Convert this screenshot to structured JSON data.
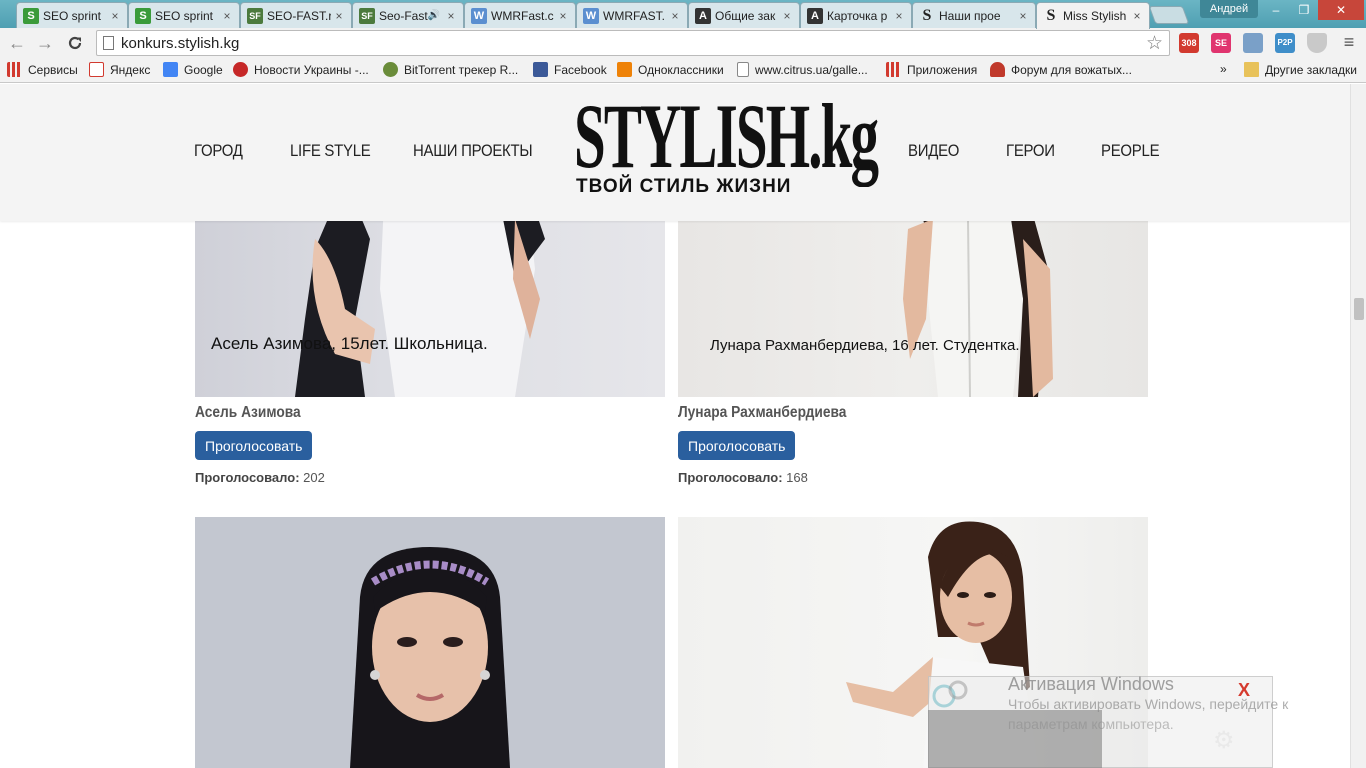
{
  "browser": {
    "tabs": [
      {
        "title": "SEO sprint",
        "icon": "seo-sprint-favicon",
        "color": "#3a9b3a"
      },
      {
        "title": "SEO sprint",
        "icon": "seo-sprint-favicon",
        "color": "#3a9b3a"
      },
      {
        "title": "SEO-FAST.ru",
        "icon": "seo-fast-favicon",
        "color": "#4c7a3d"
      },
      {
        "title": "Seo-Fast",
        "icon": "seo-fast-favicon",
        "color": "#4c7a3d",
        "audio": "🔊"
      },
      {
        "title": "WMRFast.c",
        "icon": "wmrfast-favicon",
        "color": "#5b8fd0"
      },
      {
        "title": "WMRFAST.",
        "icon": "wmrfast-favicon",
        "color": "#5b8fd0"
      },
      {
        "title": "Общие зак",
        "icon": "a-favicon",
        "color": "#333"
      },
      {
        "title": "Карточка р",
        "icon": "a-favicon",
        "color": "#333"
      },
      {
        "title": "Наши прое",
        "icon": "s-favicon",
        "color": "#fff"
      },
      {
        "title": "Miss Stylish",
        "icon": "s-favicon",
        "color": "#fff",
        "active": true
      }
    ],
    "close_glyph": "×",
    "user_name": "Андрей",
    "window_buttons": {
      "minimize": "–",
      "restore": "❐",
      "close": "✕"
    },
    "nav": {
      "back": "←",
      "forward": "→",
      "reload": "C"
    },
    "url": "konkurs.stylish.kg",
    "star_glyph": "☆",
    "extensions": [
      {
        "name": "mail-extension-icon",
        "label": "308",
        "color": "#d23a2f"
      },
      {
        "name": "se-extension-icon",
        "label": "SE",
        "color": "#e0356f"
      },
      {
        "name": "rds-extension-icon",
        "label": "",
        "color": "#7aa0c8"
      },
      {
        "name": "p2p-extension-icon",
        "label": "P2P",
        "color": "#3f8ec9"
      },
      {
        "name": "shield-extension-icon",
        "label": "",
        "color": "#bbb"
      },
      {
        "name": "menu-icon",
        "label": "≡",
        "color": "#f2f2f2"
      }
    ],
    "bookmarks": [
      {
        "label": "Сервисы",
        "icon": "apps-grid-icon",
        "color": "#d23a2f"
      },
      {
        "label": "Яндекс",
        "icon": "yandex-icon",
        "color": "#d23a2f"
      },
      {
        "label": "Google",
        "icon": "google-icon",
        "color": "#4285f4"
      },
      {
        "label": "Новости Украины -...",
        "icon": "news-ua-icon",
        "color": "#c62828"
      },
      {
        "label": "BitTorrent трекер R...",
        "icon": "torrent-icon",
        "color": "#6a8c3a"
      },
      {
        "label": "Facebook",
        "icon": "facebook-icon",
        "color": "#3b5998"
      },
      {
        "label": "Одноклассники",
        "icon": "ok-icon",
        "color": "#ee8208"
      },
      {
        "label": "www.citrus.ua/galle...",
        "icon": "page-icon",
        "color": "#fff"
      },
      {
        "label": "Приложения",
        "icon": "apps-grid-icon",
        "color": "#d23a2f"
      },
      {
        "label": "Форум для вожатых...",
        "icon": "forum-icon",
        "color": "#c0392b"
      }
    ],
    "bookmarks_overflow": "»",
    "other_bookmarks": "Другие закладки"
  },
  "site": {
    "nav_left": [
      "ГОРОД",
      "LIFE STYLE",
      "НАШИ ПРОЕКТЫ"
    ],
    "nav_right": [
      "ВИДЕО",
      "ГЕРОИ",
      "PEOPLE"
    ],
    "logo_main": "STYLISH.kg",
    "logo_sub": "ТВОЙ СТИЛЬ ЖИЗНИ",
    "vote_label": "Проголосовать",
    "votes_label": "Проголосовало:",
    "contestants": [
      {
        "photo_caption": "Асель Азимова, 15лет. Школьница.",
        "name": "Асель Азимова",
        "votes": "202"
      },
      {
        "photo_caption": "Лунара Рахманбердиева, 16 лет. Студентка.",
        "name": "Лунара Рахманбердиева",
        "votes": "168"
      },
      {
        "photo_caption": "",
        "name": "",
        "votes": ""
      },
      {
        "photo_caption": "",
        "name": "",
        "votes": ""
      }
    ]
  },
  "activation": {
    "title": "Активация Windows",
    "line1": "Чтобы активировать Windows, перейдите к",
    "line2": "параметрам компьютера.",
    "close": "X",
    "gear": "⚙"
  }
}
